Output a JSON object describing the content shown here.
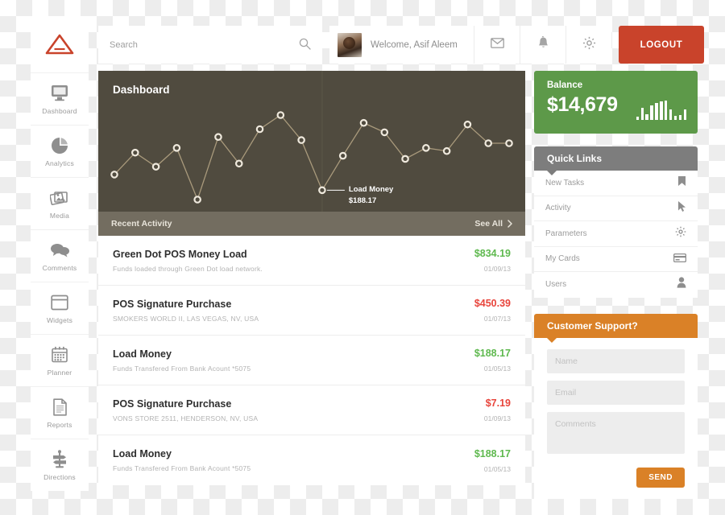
{
  "brand": {
    "logo_icon": "triangle-logo",
    "accent": "#c9432b"
  },
  "sidebar": {
    "items": [
      {
        "label": "Dashboard",
        "icon": "monitor-icon"
      },
      {
        "label": "Analytics",
        "icon": "pie-chart-icon"
      },
      {
        "label": "Media",
        "icon": "photos-icon"
      },
      {
        "label": "Comments",
        "icon": "speech-bubbles-icon"
      },
      {
        "label": "Widgets",
        "icon": "window-icon"
      },
      {
        "label": "Planner",
        "icon": "calendar-icon"
      },
      {
        "label": "Reports",
        "icon": "document-icon"
      },
      {
        "label": "Directions",
        "icon": "signpost-icon"
      }
    ]
  },
  "header": {
    "search": {
      "placeholder": "Search",
      "value": "",
      "icon": "search-icon"
    },
    "welcome": "Welcome, Asif Aleem",
    "avatar_icon": "user-avatar",
    "icons": [
      {
        "name": "mail-icon"
      },
      {
        "name": "bell-icon"
      },
      {
        "name": "gear-icon"
      }
    ],
    "logout_label": "LOGOUT"
  },
  "dashboard": {
    "title": "Dashboard",
    "annotation": {
      "label": "Load Money",
      "amount": "$188.17"
    },
    "activity_bar": {
      "title": "Recent Activity",
      "see_all": "See All",
      "chevron": "chevron-right-icon"
    }
  },
  "chart_data": {
    "type": "line",
    "title": "Dashboard",
    "xlabel": "",
    "ylabel": "",
    "grid": false,
    "legend": "none",
    "marker": "open-circle",
    "line_color": "#a99a7c",
    "background": "#504b3f",
    "x": [
      1,
      2,
      3,
      4,
      5,
      6,
      7,
      8,
      9,
      10,
      11,
      12,
      13,
      14,
      15,
      16,
      17,
      18,
      19,
      20
    ],
    "values": [
      28,
      42,
      33,
      45,
      12,
      52,
      35,
      57,
      66,
      50,
      18,
      40,
      61,
      55,
      38,
      45,
      43,
      60,
      48,
      48
    ],
    "annotations": [
      {
        "x": 11,
        "label": "Load Money",
        "value": "$188.17"
      }
    ]
  },
  "transactions": [
    {
      "title": "Green Dot POS Money Load",
      "desc": "Funds loaded through Green Dot load network.",
      "amount": "$834.19",
      "type": "credit",
      "date": "01/09/13"
    },
    {
      "title": "POS Signature Purchase",
      "desc": "SMOKERS WORLD II, LAS VEGAS, NV, USA",
      "amount": "$450.39",
      "type": "debit",
      "date": "01/07/13"
    },
    {
      "title": "Load Money",
      "desc": "Funds Transfered From Bank Acount *5075",
      "amount": "$188.17",
      "type": "credit",
      "date": "01/05/13"
    },
    {
      "title": "POS Signature Purchase",
      "desc": "VONS STORE 2511, HENDERSON, NV, USA",
      "amount": "$7.19",
      "type": "debit",
      "date": "01/09/13"
    },
    {
      "title": "Load Money",
      "desc": "Funds Transfered From Bank Acount *5075",
      "amount": "$188.17",
      "type": "credit",
      "date": "01/05/13"
    }
  ],
  "balance": {
    "label": "Balance",
    "value": "$14,679",
    "color": "#5d9949",
    "sparkline": [
      4,
      15,
      7,
      18,
      21,
      23,
      24,
      13,
      5,
      6,
      13
    ]
  },
  "quick_links": {
    "title": "Quick Links",
    "items": [
      {
        "label": "New Tasks",
        "icon": "bookmark-icon"
      },
      {
        "label": "Activity",
        "icon": "cursor-icon"
      },
      {
        "label": "Parameters",
        "icon": "gear-icon"
      },
      {
        "label": "My Cards",
        "icon": "credit-card-icon"
      },
      {
        "label": "Users",
        "icon": "user-icon"
      }
    ]
  },
  "support": {
    "title": "Customer Support?",
    "color": "#da8127",
    "name_placeholder": "Name",
    "name_value": "",
    "email_placeholder": "Email",
    "email_value": "",
    "comments_placeholder": "Comments",
    "comments_value": "",
    "send_label": "SEND"
  }
}
